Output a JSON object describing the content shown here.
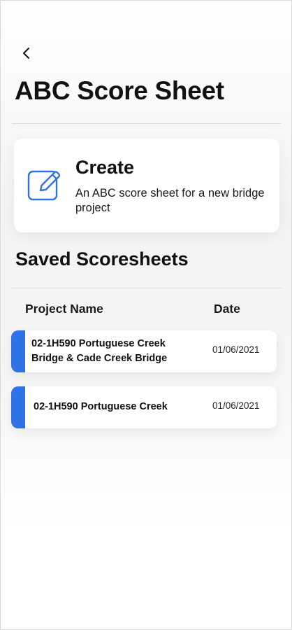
{
  "header": {
    "back_icon": "chevron-left-icon",
    "title": "ABC Score Sheet"
  },
  "create_card": {
    "icon": "edit-icon",
    "title": "Create",
    "description": "An ABC score sheet for a new bridge project"
  },
  "saved": {
    "title": "Saved Scoresheets",
    "columns": {
      "name": "Project Name",
      "date": "Date"
    },
    "rows": [
      {
        "name": "02-1H590 Portuguese Creek Bridge & Cade Creek Bridge",
        "date": "01/06/2021"
      },
      {
        "name": "02-1H590 Portuguese Creek",
        "date": "01/06/2021"
      }
    ]
  },
  "colors": {
    "accent": "#2f72e8",
    "background": "#ffffff",
    "card": "#ffffff",
    "text": "#111111"
  }
}
